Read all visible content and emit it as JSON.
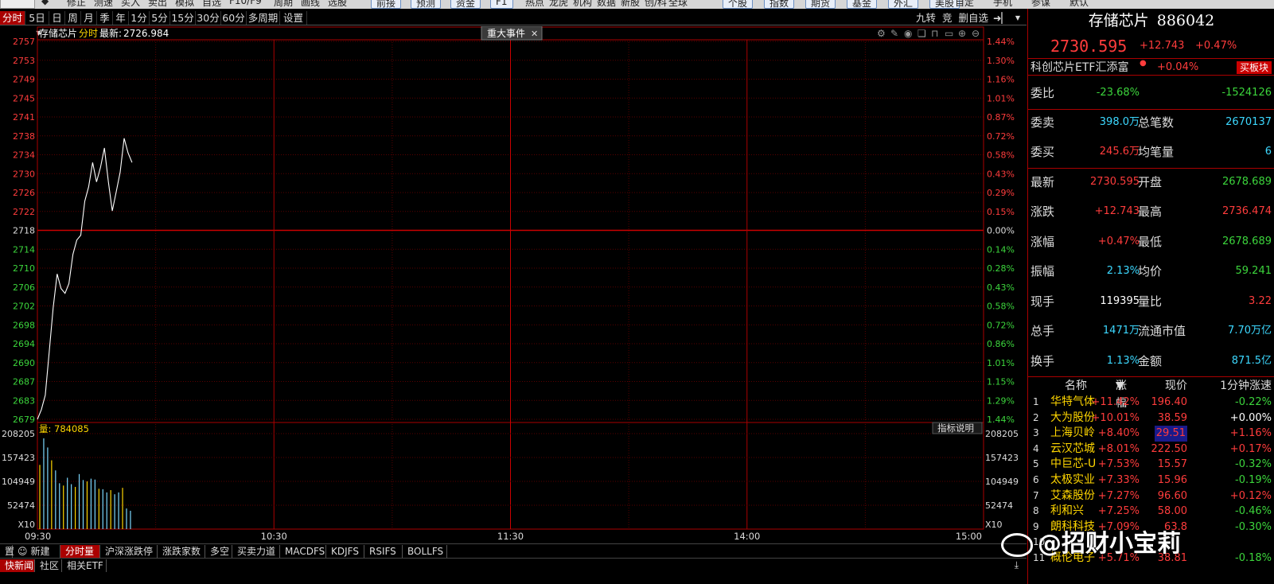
{
  "toolbar": {
    "items": [
      "修正",
      "测速",
      "买入",
      "卖出",
      "模拟",
      "自选",
      "F10/F9",
      "周期",
      "画线",
      "选股"
    ],
    "boxed": [
      "前接",
      "预测",
      "资金",
      "F1"
    ],
    "items_mid": [
      "热点",
      "龙虎",
      "机构",
      "数据",
      "新股",
      "创/科",
      "全球"
    ],
    "boxed2": [
      "个股",
      "指数",
      "期货",
      "基金",
      "外汇",
      "美股"
    ],
    "items_right": [
      "自定",
      "手机",
      "参谋",
      "默认"
    ]
  },
  "period_tabs": {
    "items": [
      "分时",
      "5日",
      "日",
      "周",
      "月",
      "季",
      "年",
      "1分",
      "5分",
      "15分",
      "30分",
      "60分",
      "多周期",
      "设置"
    ],
    "active": "分时",
    "right": [
      "九转",
      "竞",
      "删自选"
    ]
  },
  "chart": {
    "header_name": "存储芯片",
    "header_mode": "分时",
    "header_latest_label": "最新:",
    "header_latest": "2726.984",
    "event_tab": "重大事件",
    "volume_label": "量: 784085",
    "indicator_btn": "指标说明",
    "multiplier": "X10"
  },
  "chart_data": {
    "type": "line",
    "title": "存储芯片 分时",
    "prev_close": 2718,
    "price_ticks": [
      2757,
      2753,
      2749,
      2745,
      2741,
      2738,
      2734,
      2730,
      2726,
      2722,
      2718,
      2714,
      2710,
      2706,
      2702,
      2698,
      2694,
      2690,
      2687,
      2683,
      2679
    ],
    "pct_ticks": [
      "1.44%",
      "1.30%",
      "1.16%",
      "1.01%",
      "0.87%",
      "0.72%",
      "0.58%",
      "0.43%",
      "0.29%",
      "0.15%",
      "0.00%",
      "0.14%",
      "0.28%",
      "0.43%",
      "0.58%",
      "0.72%",
      "0.86%",
      "1.01%",
      "1.15%",
      "1.29%",
      "1.44%"
    ],
    "ylim": [
      2679,
      2757
    ],
    "x_labels": [
      "09:30",
      "10:30",
      "11:30",
      "14:00",
      "15:00"
    ],
    "session_minutes": 240,
    "price_series": [
      [
        0,
        2679
      ],
      [
        1,
        2681
      ],
      [
        2,
        2684
      ],
      [
        3,
        2693
      ],
      [
        4,
        2702
      ],
      [
        5,
        2709
      ],
      [
        6,
        2706
      ],
      [
        7,
        2705
      ],
      [
        8,
        2707
      ],
      [
        9,
        2713
      ],
      [
        10,
        2716
      ],
      [
        11,
        2717
      ],
      [
        12,
        2724
      ],
      [
        13,
        2727
      ],
      [
        14,
        2732
      ],
      [
        15,
        2728
      ],
      [
        16,
        2731
      ],
      [
        17,
        2735
      ],
      [
        18,
        2728
      ],
      [
        19,
        2722
      ],
      [
        20,
        2726
      ],
      [
        21,
        2730
      ],
      [
        22,
        2737
      ],
      [
        23,
        2734
      ],
      [
        24,
        2732
      ]
    ],
    "volume_ticks": [
      "208205",
      "157423",
      "104949",
      "52474"
    ],
    "volume_ylim": [
      0,
      208205
    ],
    "volume_series": [
      [
        0,
        140000
      ],
      [
        1,
        198000
      ],
      [
        2,
        178000
      ],
      [
        3,
        150000
      ],
      [
        4,
        128000
      ],
      [
        5,
        100000
      ],
      [
        6,
        95000
      ],
      [
        7,
        112000
      ],
      [
        8,
        98000
      ],
      [
        9,
        92000
      ],
      [
        10,
        120000
      ],
      [
        11,
        107000
      ],
      [
        12,
        104000
      ],
      [
        13,
        110000
      ],
      [
        14,
        108000
      ],
      [
        15,
        88000
      ],
      [
        16,
        87000
      ],
      [
        17,
        80000
      ],
      [
        18,
        85000
      ],
      [
        19,
        76000
      ],
      [
        20,
        80000
      ],
      [
        21,
        90000
      ],
      [
        22,
        45000
      ],
      [
        23,
        40000
      ]
    ]
  },
  "indicator_tabs": {
    "items": [
      "置",
      "新建",
      "分时量",
      "沪深涨跌停",
      "涨跌家数",
      "多空",
      "买卖力道",
      "MACDFS",
      "KDJFS",
      "RSIFS",
      "BOLLFS"
    ],
    "active": "分时量"
  },
  "bottom_tabs": {
    "items": [
      "快新闻",
      "社区",
      "相关ETF"
    ],
    "active": "快新闻"
  },
  "panel": {
    "name": "存储芯片",
    "code": "886042",
    "price": "2730.595",
    "change": "+12.743",
    "change_pct": "+0.47%",
    "etf_name": "科创芯片ETF汇添富",
    "etf_change": "+0.04%",
    "etf_button": "买板块",
    "quotes": [
      {
        "l1": "委比",
        "v1": "-23.68%",
        "c1": "green",
        "l2": "",
        "v2": "-1524126",
        "c2": "green"
      },
      {
        "l1": "委卖",
        "v1": "398.0万",
        "c1": "cyan",
        "l2": "总笔数",
        "v2": "2670137",
        "c2": "cyan"
      },
      {
        "l1": "委买",
        "v1": "245.6万",
        "c1": "red",
        "l2": "均笔量",
        "v2": "6",
        "c2": "cyan"
      },
      {
        "l1": "最新",
        "v1": "2730.595",
        "c1": "red",
        "l2": "开盘",
        "v2": "2678.689",
        "c2": "green"
      },
      {
        "l1": "涨跌",
        "v1": "+12.743",
        "c1": "red",
        "l2": "最高",
        "v2": "2736.474",
        "c2": "red"
      },
      {
        "l1": "涨幅",
        "v1": "+0.47%",
        "c1": "red",
        "l2": "最低",
        "v2": "2678.689",
        "c2": "green"
      },
      {
        "l1": "振幅",
        "v1": "2.13%",
        "c1": "cyan",
        "l2": "均价",
        "v2": "59.241",
        "c2": "green"
      },
      {
        "l1": "现手",
        "v1": "119395",
        "c1": "white",
        "l2": "量比",
        "v2": "3.22",
        "c2": "red"
      },
      {
        "l1": "总手",
        "v1": "1471万",
        "c1": "cyan",
        "l2": "流通市值",
        "v2": "7.70万亿",
        "c2": "cyan"
      },
      {
        "l1": "换手",
        "v1": "1.13%",
        "c1": "cyan",
        "l2": "金额",
        "v2": "871.5亿",
        "c2": "cyan"
      }
    ],
    "rank_head": {
      "name": "名称",
      "pct": "涨幅",
      "price": "现价",
      "speed": "1分钟涨速"
    },
    "rank": [
      {
        "i": "1",
        "name": "华特气体",
        "pct": "+11.42%",
        "price": "196.40",
        "speed": "-0.22%",
        "sc": "green"
      },
      {
        "i": "2",
        "name": "大为股份",
        "pct": "+10.01%",
        "price": "38.59",
        "speed": "+0.00%",
        "sc": "white"
      },
      {
        "i": "3",
        "name": "上海贝岭",
        "pct": "+8.40%",
        "price": "29.51",
        "speed": "+1.16%",
        "sc": "red"
      },
      {
        "i": "4",
        "name": "云汉芯城",
        "pct": "+8.01%",
        "price": "222.50",
        "speed": "+0.17%",
        "sc": "red"
      },
      {
        "i": "5",
        "name": "中巨芯-U",
        "pct": "+7.53%",
        "price": "15.57",
        "speed": "-0.32%",
        "sc": "green"
      },
      {
        "i": "6",
        "name": "太极实业",
        "pct": "+7.33%",
        "price": "15.96",
        "speed": "-0.19%",
        "sc": "green"
      },
      {
        "i": "7",
        "name": "艾森股份",
        "pct": "+7.27%",
        "price": "96.60",
        "speed": "+0.12%",
        "sc": "red"
      },
      {
        "i": "8",
        "name": "利和兴",
        "pct": "+7.25%",
        "price": "58.00",
        "speed": "-0.46%",
        "sc": "green"
      },
      {
        "i": "9",
        "name": "朗科科技",
        "pct": "+7.09%",
        "price": "63.8",
        "speed": "-0.30%",
        "sc": "green"
      },
      {
        "i": "10",
        "name": "",
        "pct": "",
        "price": "",
        "speed": "",
        "sc": "green"
      },
      {
        "i": "11",
        "name": "概伦电子",
        "pct": "+5.71%",
        "price": "38.81",
        "speed": "-0.18%",
        "sc": "green"
      }
    ]
  },
  "watermark": "@招财小宝莉"
}
